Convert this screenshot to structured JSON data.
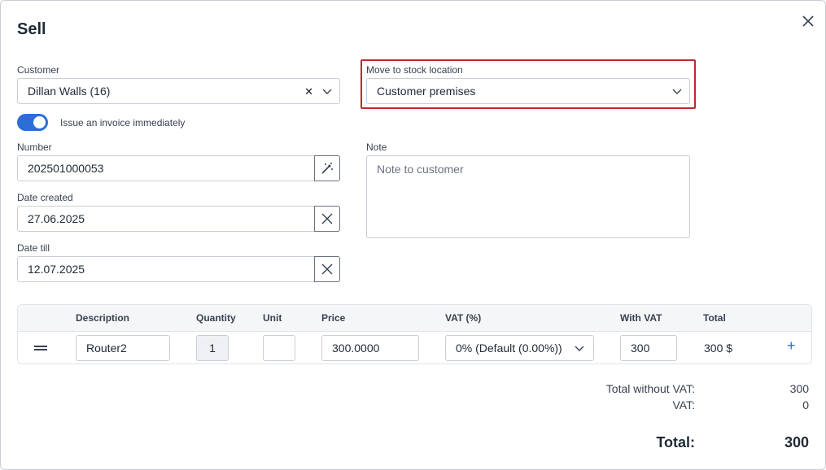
{
  "dialog": {
    "title": "Sell"
  },
  "customer": {
    "label": "Customer",
    "value": "Dillan Walls (16)"
  },
  "stock_location": {
    "label": "Move to stock location",
    "value": "Customer premises"
  },
  "invoice_toggle": {
    "label": "Issue an invoice immediately",
    "checked": true
  },
  "number": {
    "label": "Number",
    "value": "202501000053"
  },
  "note": {
    "label": "Note",
    "placeholder": "Note to customer"
  },
  "date_created": {
    "label": "Date created",
    "value": "27.06.2025"
  },
  "date_till": {
    "label": "Date till",
    "value": "12.07.2025"
  },
  "table": {
    "headers": {
      "description": "Description",
      "quantity": "Quantity",
      "unit": "Unit",
      "price": "Price",
      "vat": "VAT (%)",
      "with_vat": "With VAT",
      "total": "Total"
    },
    "rows": [
      {
        "description": "Router2",
        "quantity": "1",
        "unit": "",
        "price": "300.0000",
        "vat": "0% (Default (0.00%))",
        "with_vat": "300",
        "total": "300 $"
      }
    ]
  },
  "summary": {
    "without_vat_label": "Total without VAT:",
    "without_vat_value": "300",
    "vat_label": "VAT:",
    "vat_value": "0",
    "total_label": "Total:",
    "total_value": "300"
  },
  "colors": {
    "accent": "#2b6fd6",
    "highlight_border": "#c0272d"
  },
  "icons": {
    "close": "close-icon",
    "clear": "clear-x-icon",
    "chevron": "chevron-down-icon",
    "generate": "magic-wand-icon",
    "drag": "drag-handle-icon",
    "add": "plus-icon"
  }
}
